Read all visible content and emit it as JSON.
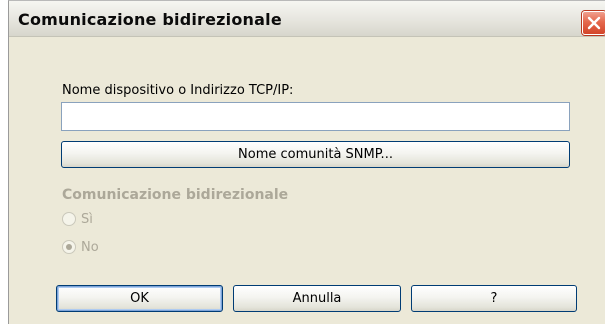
{
  "window": {
    "title": "Comunicazione bidirezionale"
  },
  "address": {
    "label": "Nome dispositivo o Indirizzo TCP/IP:",
    "value": "",
    "placeholder": ""
  },
  "snmp_button": {
    "label": "Nome comunità SNMP..."
  },
  "bidirectional": {
    "heading": "Comunicazione bidirezionale",
    "enabled": false,
    "options": [
      {
        "label": "Sì",
        "checked": false
      },
      {
        "label": "No",
        "checked": true
      }
    ]
  },
  "buttons": {
    "ok": "OK",
    "cancel": "Annulla",
    "help": "?"
  },
  "colors": {
    "dialog_background": "#ece9d8",
    "button_border": "#003c74",
    "disabled_text": "#aca899",
    "close_button": "#e5694d"
  },
  "icons": {
    "close": "close-icon"
  }
}
